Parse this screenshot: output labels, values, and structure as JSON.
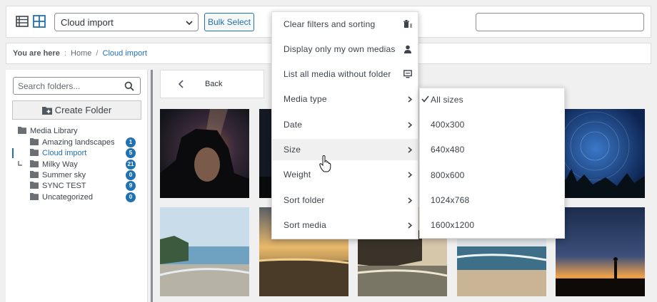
{
  "colors": {
    "accent": "#2271b1",
    "panel": "#ffffff",
    "page_bg": "#f0f0f1",
    "menu_hover": "#f0f0f1"
  },
  "toolbar": {
    "list_view_icon": "list-view-icon",
    "grid_view_icon": "grid-view-icon",
    "folder_select_value": "Cloud import",
    "bulk_select_label": "Bulk Select",
    "search_value": ""
  },
  "breadcrumb": {
    "label": "You are here",
    "separator": ":",
    "home": "Home",
    "divider": "/",
    "current": "Cloud import"
  },
  "sidebar": {
    "search_placeholder": "Search folders...",
    "create_folder_label": "Create Folder",
    "tree": {
      "root": "Media Library",
      "folders": [
        {
          "label": "Amazing landscapes",
          "count": "1"
        },
        {
          "label": "Cloud import",
          "count": "5"
        },
        {
          "label": "Milky Way",
          "count": "21"
        },
        {
          "label": "Summer sky",
          "count": "0"
        },
        {
          "label": "SYNC TEST",
          "count": "9"
        },
        {
          "label": "Uncategorized",
          "count": "0"
        }
      ]
    }
  },
  "main": {
    "back_label": "Back"
  },
  "context_menu": {
    "items": [
      {
        "label": "Clear filters and sorting",
        "icon": "clear-filter-icon"
      },
      {
        "label": "Display only my own medias",
        "icon": "user-icon"
      },
      {
        "label": "List all media without folder",
        "icon": "monitor-icon"
      },
      {
        "label": "Media type",
        "icon": "chevron-right-icon"
      },
      {
        "label": "Date",
        "icon": "chevron-right-icon"
      },
      {
        "label": "Size",
        "icon": "chevron-right-icon"
      },
      {
        "label": "Weight",
        "icon": "chevron-right-icon"
      },
      {
        "label": "Sort folder",
        "icon": "chevron-right-icon"
      },
      {
        "label": "Sort media",
        "icon": "chevron-right-icon"
      }
    ],
    "size_submenu": [
      "All sizes",
      "400x300",
      "640x480",
      "800x600",
      "1024x768",
      "1600x1200"
    ],
    "size_selected": "All sizes"
  }
}
